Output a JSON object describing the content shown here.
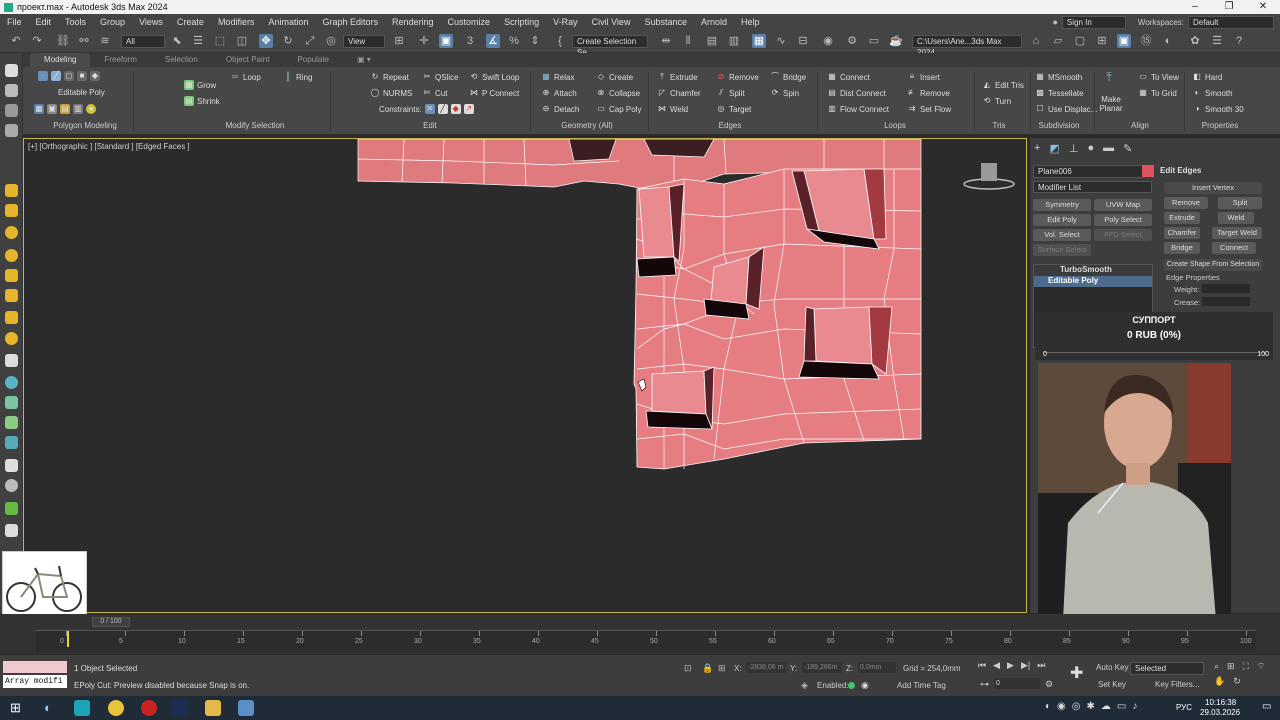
{
  "window": {
    "title": "проект.max - Autodesk 3ds Max 2024",
    "controls": [
      "–",
      "❐",
      "✕"
    ]
  },
  "menu": {
    "items": [
      "File",
      "Edit",
      "Tools",
      "Group",
      "Views",
      "Create",
      "Modifiers",
      "Animation",
      "Graph Editors",
      "Rendering",
      "Customize",
      "Scripting",
      "V-Ray",
      "Civil View",
      "Substance",
      "Arnold",
      "Help"
    ],
    "sign_in": "Sign In",
    "workspaces_label": "Workspaces:",
    "workspaces_value": "Default"
  },
  "toolbar": {
    "selection_filter": "All",
    "ref_coord": "View",
    "named_selection": "Create Selection Se",
    "path": "C:\\Users\\Ane...3ds Max 2024"
  },
  "ribbon_tabs": [
    "Modeling",
    "Freeform",
    "Selection",
    "Object Paint",
    "Populate"
  ],
  "ribbon": {
    "polygon_modeling": {
      "sub": "Editable Poly",
      "label": "Polygon Modeling"
    },
    "modify_selection": {
      "grow": "Grow",
      "shrink": "Shrink",
      "loop": "Loop",
      "ring": "Ring",
      "label": "Modify Selection"
    },
    "edit": {
      "repeat": "Repeat",
      "qslice": "QSlice",
      "swift_loop": "Swift Loop",
      "nurms": "NURMS",
      "cut": "Cut",
      "p_connect": "P Connect",
      "constraints": "Constraints:",
      "label": "Edit"
    },
    "geometry": {
      "relax": "Relax",
      "create": "Create",
      "attach": "Attach",
      "collapse": "Collapse",
      "detach": "Detach",
      "cap_poly": "Cap Poly",
      "label": "Geometry (All)"
    },
    "edges": {
      "extrude": "Extrude",
      "remove": "Remove",
      "bridge": "Bridge",
      "chamfer": "Chamfer",
      "split": "Split",
      "spin": "Spin",
      "weld": "Weld",
      "target": "Target",
      "label": "Edges"
    },
    "loops": {
      "connect": "Connect",
      "insert": "Insert",
      "dist_connect": "Dist Connect",
      "remove": "Remove",
      "flow_connect": "Flow Connect",
      "set_flow": "Set Flow",
      "label": "Loops"
    },
    "tris": {
      "edit_tris": "Edit Tris",
      "turn": "Turn",
      "label": "Tris"
    },
    "subdivision": {
      "msmooth": "MSmooth",
      "tessellate": "Tessellate",
      "use_displac": "Use Displac...",
      "label": "Subdivision"
    },
    "align": {
      "make_planar": "Make Planar",
      "to_view": "To View",
      "to_grid": "To Grid",
      "label": "Align"
    },
    "properties": {
      "hard": "Hard",
      "smooth": "Smooth",
      "smooth30": "Smooth 30",
      "label": "Properties"
    }
  },
  "viewport": {
    "label": "[+] [Orthographic ] [Standard ] [Edged Faces ]"
  },
  "command_panel": {
    "object_name": "Plane006",
    "modifier_list": "Modifier List",
    "buttons": [
      "Symmetry",
      "UVW Map",
      "Edit Poly",
      "Poly Select",
      "Vol. Select",
      "FFD Select",
      "Surface Select"
    ],
    "stack": [
      "TurboSmooth",
      "Editable Poly"
    ],
    "edit_edges": {
      "title": "Edit Edges",
      "insert_vertex": "Insert Vertex",
      "remove": "Remove",
      "split": "Split",
      "extrude": "Extrude",
      "weld": "Weld",
      "chamfer": "Chamfer",
      "target_weld": "Target Weld",
      "bridge": "Bridge",
      "connect": "Connect",
      "create_shape": "Create Shape From Selection",
      "edge_properties": "Edge Properties",
      "weight": "Weight:",
      "crease": "Crease:"
    }
  },
  "support": {
    "title": "СУППОРТ",
    "amount": "0 RUB (0%)",
    "min": "0",
    "max": "100",
    "progress": 0
  },
  "timeline": {
    "current": "0 / 100",
    "ticks": [
      "0",
      "5",
      "10",
      "15",
      "20",
      "25",
      "30",
      "35",
      "40",
      "45",
      "50",
      "55",
      "60",
      "65",
      "70",
      "75",
      "80",
      "85",
      "90",
      "95",
      "100"
    ]
  },
  "status": {
    "maxscript": "Array modifi",
    "selected": "1 Object Selected",
    "prompt": "EPoly Cut: Preview disabled because Snap is on.",
    "x_label": "X:",
    "x_value": "-2838,06 m",
    "y_label": "Y:",
    "y_value": "-189,266m",
    "z_label": "Z:",
    "z_value": "0,0mm",
    "grid": "Grid = 254,0mm",
    "enabled": "Enabled:",
    "add_time_tag": "Add Time Tag",
    "auto_key": "Auto Key",
    "set_key": "Set Key",
    "selected_dropdown": "Selected",
    "key_filters": "Key Filters...",
    "frame": "0"
  },
  "taskbar": {
    "time": "10:16:38",
    "date": "29.03.2026",
    "lang": "РУС"
  }
}
